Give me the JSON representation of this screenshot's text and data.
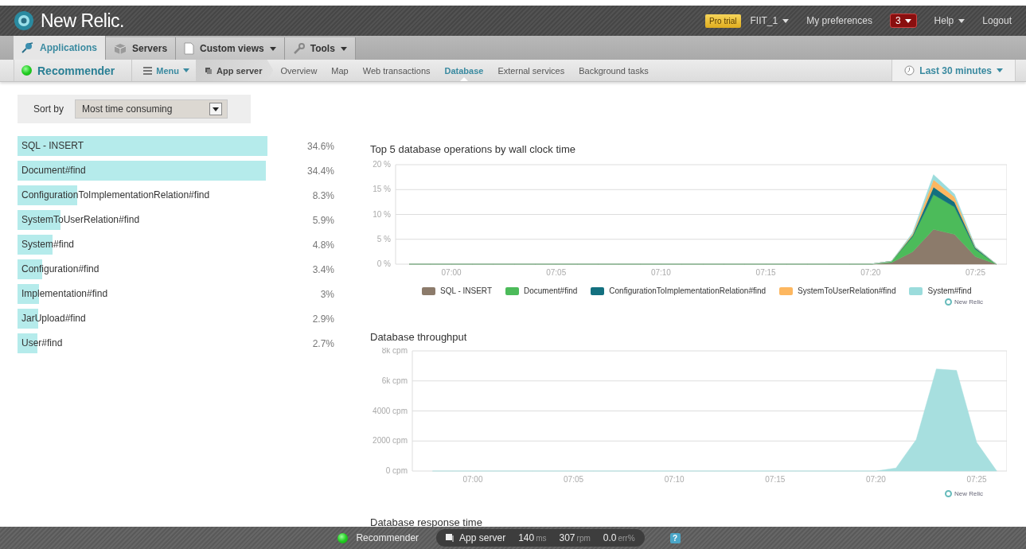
{
  "header": {
    "logo": "New Relic.",
    "trial_badge": "Pro trial",
    "account": "FIIT_1",
    "preferences": "My preferences",
    "notifications": "3",
    "help": "Help",
    "logout": "Logout"
  },
  "tabs": [
    {
      "label": "Applications",
      "kind": "apps",
      "selected": true,
      "has_menu": false
    },
    {
      "label": "Servers",
      "kind": "servers",
      "selected": false,
      "has_menu": false
    },
    {
      "label": "Custom views",
      "kind": "views",
      "selected": false,
      "has_menu": true
    },
    {
      "label": "Tools",
      "kind": "tools",
      "selected": false,
      "has_menu": true
    }
  ],
  "app_bar": {
    "app_name": "Recommender",
    "menu": "Menu",
    "breadcrumb": "App server",
    "time_range": "Last 30 minutes",
    "links": [
      {
        "label": "Overview",
        "selected": false
      },
      {
        "label": "Map",
        "selected": false
      },
      {
        "label": "Web transactions",
        "selected": false
      },
      {
        "label": "Database",
        "selected": true
      },
      {
        "label": "External services",
        "selected": false
      },
      {
        "label": "Background tasks",
        "selected": false
      }
    ]
  },
  "sort": {
    "label": "Sort by",
    "value": "Most time consuming"
  },
  "operations": [
    {
      "name": "SQL - INSERT",
      "share": "34.6%"
    },
    {
      "name": "Document#find",
      "share": "34.4%"
    },
    {
      "name": "ConfigurationToImplementationRelation#find",
      "share": "8.3%"
    },
    {
      "name": "SystemToUserRelation#find",
      "share": "5.9%"
    },
    {
      "name": "System#find",
      "share": "4.8%"
    },
    {
      "name": "Configuration#find",
      "share": "3.4%"
    },
    {
      "name": "Implementation#find",
      "share": "3%"
    },
    {
      "name": "JarUpload#find",
      "share": "2.9%"
    },
    {
      "name": "User#find",
      "share": "2.7%"
    }
  ],
  "charts": [
    {
      "credit": "New Relic",
      "chart_data": {
        "type": "area",
        "title": "Top 5 database operations by wall clock time",
        "stacked": true,
        "categories": [
          null,
          null,
          "07:00",
          null,
          null,
          null,
          null,
          "07:05",
          null,
          null,
          null,
          null,
          "07:10",
          null,
          null,
          null,
          null,
          "07:15",
          null,
          null,
          null,
          null,
          "07:20",
          null,
          null,
          null,
          null,
          "07:25",
          null
        ],
        "series": [
          {
            "name": "SQL - INSERT",
            "color": "#8c7b6b",
            "values": [
              0,
              0,
              0,
              0,
              0,
              0,
              0,
              0,
              0,
              0,
              0,
              0,
              0,
              0,
              0,
              0,
              0,
              0,
              0,
              0,
              0,
              0,
              0,
              0.3,
              2.5,
              7,
              6,
              1.5,
              0
            ]
          },
          {
            "name": "Document#find",
            "color": "#4cbb5a",
            "values": [
              0,
              0,
              0,
              0,
              0,
              0,
              0,
              0,
              0,
              0,
              0,
              0,
              0,
              0,
              0,
              0,
              0,
              0,
              0,
              0,
              0,
              0,
              0,
              0.3,
              3,
              7,
              5.5,
              1.5,
              0
            ]
          },
          {
            "name": "ConfigurationToImplementationRelation#find",
            "color": "#13707f",
            "values": [
              0,
              0,
              0,
              0,
              0,
              0,
              0,
              0,
              0,
              0,
              0,
              0,
              0,
              0,
              0,
              0,
              0,
              0,
              0,
              0,
              0,
              0,
              0,
              0,
              0.3,
              1.5,
              1,
              0.3,
              0
            ]
          },
          {
            "name": "SystemToUserRelation#find",
            "color": "#fdb760",
            "values": [
              0,
              0,
              0,
              0,
              0,
              0,
              0,
              0,
              0,
              0,
              0,
              0,
              0,
              0,
              0,
              0,
              0,
              0,
              0,
              0,
              0,
              0,
              0,
              0,
              0.3,
              1.5,
              1,
              0.1,
              0
            ]
          },
          {
            "name": "System#find",
            "color": "#9bdcdc",
            "values": [
              0,
              0,
              0,
              0,
              0,
              0,
              0,
              0,
              0,
              0,
              0,
              0,
              0,
              0,
              0,
              0,
              0,
              0,
              0,
              0,
              0,
              0,
              0,
              0,
              0.2,
              1,
              0.6,
              0.1,
              0
            ]
          }
        ],
        "ylim": [
          0,
          20
        ],
        "grid": true,
        "legend": "bottom",
        "yticks": [
          {
            "value": 0,
            "label": "0 %"
          },
          {
            "value": 5,
            "label": "5 %"
          },
          {
            "value": 10,
            "label": "10 %"
          },
          {
            "value": 15,
            "label": "15 %"
          },
          {
            "value": 20,
            "label": "20 %"
          }
        ]
      }
    },
    {
      "credit": "New Relic",
      "chart_data": {
        "type": "area",
        "title": "Database throughput",
        "categories": [
          null,
          null,
          "07:00",
          null,
          null,
          null,
          null,
          "07:05",
          null,
          null,
          null,
          null,
          "07:10",
          null,
          null,
          null,
          null,
          "07:15",
          null,
          null,
          null,
          null,
          "07:20",
          null,
          null,
          null,
          null,
          "07:25",
          null
        ],
        "series": [
          {
            "color": "#a7dfdf",
            "values": [
              0,
              0,
              0,
              0,
              0,
              0,
              0,
              0,
              0,
              0,
              0,
              0,
              0,
              0,
              0,
              0,
              0,
              0,
              0,
              0,
              0,
              0,
              0,
              200,
              2100,
              6800,
              6700,
              1900,
              0
            ]
          }
        ],
        "ylim": [
          0,
          8000
        ],
        "grid": true,
        "yticks": [
          {
            "value": 0,
            "label": "0 cpm"
          },
          {
            "value": 2000,
            "label": "2000 cpm"
          },
          {
            "value": 4000,
            "label": "4000 cpm"
          },
          {
            "value": 6000,
            "label": "6k cpm"
          },
          {
            "value": 8000,
            "label": "8k cpm"
          }
        ]
      }
    }
  ],
  "next_section": "Database response time",
  "footer": {
    "app": "Recommender",
    "server": "App server",
    "response": "140",
    "response_unit": "ms",
    "throughput": "307",
    "throughput_unit": "rpm",
    "errors": "0.0",
    "errors_unit": "err%",
    "help": "?"
  }
}
